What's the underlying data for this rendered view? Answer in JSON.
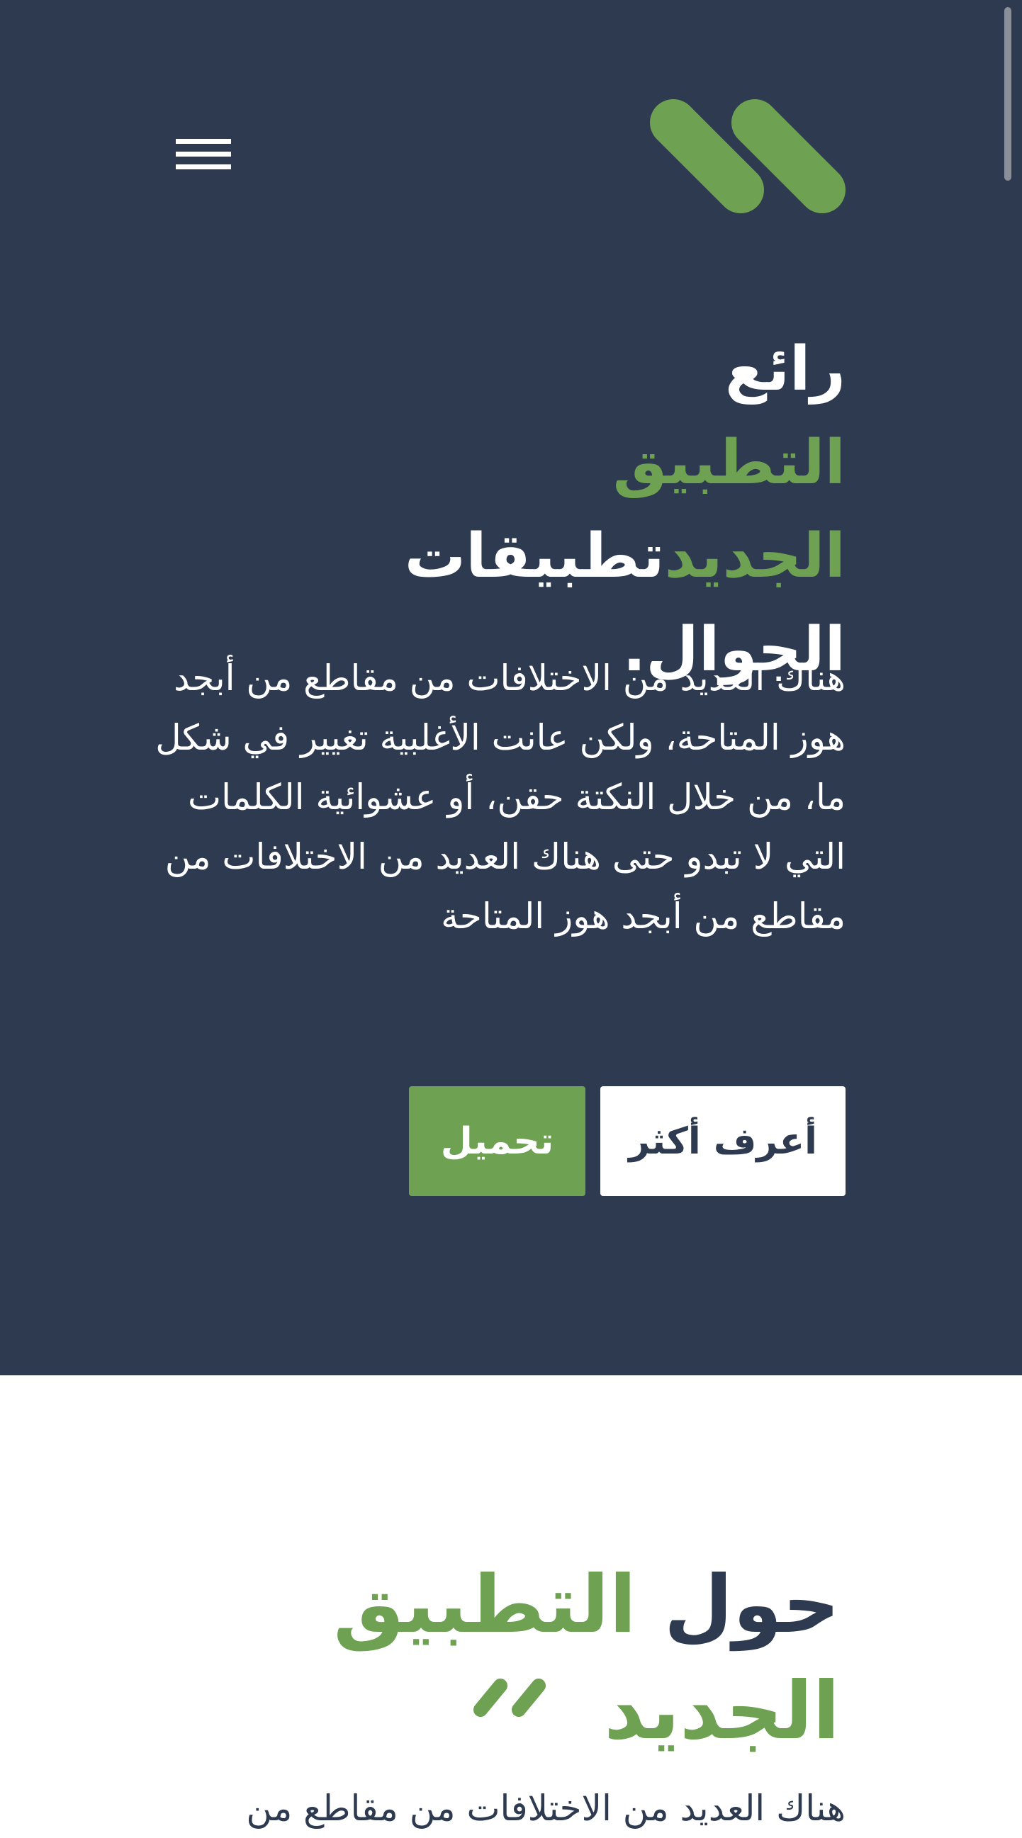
{
  "colors": {
    "hero_background": "#2d3a50",
    "accent": "#6ea152",
    "text_light": "#ffffff",
    "text_dark": "#2d3a50"
  },
  "header": {
    "logo_icon": "double-slash-logo-icon",
    "menu_icon": "hamburger-menu-icon"
  },
  "hero": {
    "title_line1": "رائع",
    "title_accent": "التطبيق الجديد",
    "title_line2_rest": "تطبيقات",
    "title_line3": "الجوال.",
    "description": "هناك العديد من الاختلافات من مقاطع من أبجد هوز المتاحة، ولكن عانت الأغلبية تغيير في شكل ما، من خلال النكتة حقن، أو عشوائية الكلمات التي لا تبدو حتى هناك العديد من الاختلافات من مقاطع من أبجد هوز المتاحة",
    "learn_more_label": "أعرف أكثر",
    "download_label": "تحميل"
  },
  "about": {
    "title_prefix": "حول",
    "title_accent": "التطبيق الجديد",
    "divider_icon": "double-slash-divider-icon",
    "description_start": "هناك العديد من الاختلافات من مقاطع من"
  }
}
